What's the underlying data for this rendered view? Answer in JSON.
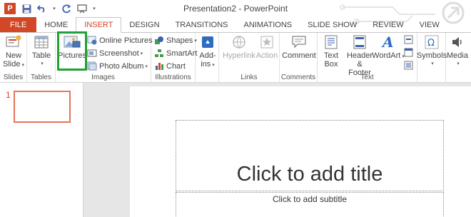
{
  "app": {
    "icon_letter": "P",
    "title": "Presentation2 - PowerPoint"
  },
  "tabs": [
    "FILE",
    "HOME",
    "INSERT",
    "DESIGN",
    "TRANSITIONS",
    "ANIMATIONS",
    "SLIDE SHOW",
    "REVIEW",
    "VIEW"
  ],
  "active_tab": "INSERT",
  "ribbon": {
    "slides": {
      "new_slide_1": "New",
      "new_slide_2": "Slide",
      "label": "Slides"
    },
    "tables": {
      "table": "Table",
      "label": "Tables"
    },
    "images": {
      "pictures": "Pictures",
      "online_pictures": "Online Pictures",
      "screenshot": "Screenshot",
      "photo_album": "Photo Album",
      "label": "Images"
    },
    "illustrations": {
      "shapes": "Shapes",
      "smartart": "SmartArt",
      "chart": "Chart",
      "label": "Illustrations"
    },
    "apps": {
      "addins_1": "Add-",
      "addins_2": "ins"
    },
    "links": {
      "hyperlink": "Hyperlink",
      "action": "Action",
      "label": "Links"
    },
    "comments": {
      "comment": "Comment",
      "label": "Comments"
    },
    "text": {
      "textbox_1": "Text",
      "textbox_2": "Box",
      "header_1": "Header",
      "header_2": "& Footer",
      "wordart": "WordArt",
      "label": "Text"
    },
    "symbols": {
      "symbols": "Symbols"
    },
    "media": {
      "media": "Media"
    }
  },
  "slide_pane": {
    "number": "1"
  },
  "slide": {
    "title_placeholder": "Click to add title",
    "subtitle_placeholder": "Click to add subtitle"
  },
  "colors": {
    "accent": "#d24726",
    "highlight": "#1fa135"
  }
}
